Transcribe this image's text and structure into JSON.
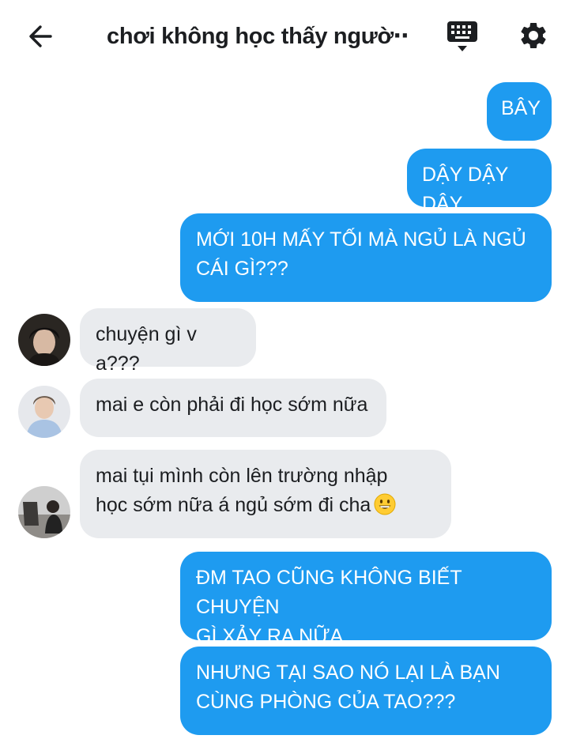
{
  "header": {
    "title": "chơi không học thấy ngườ⋯",
    "back_icon": "arrow-left-icon",
    "keyboard_icon": "keyboard-icon",
    "settings_icon": "gear-icon"
  },
  "colors": {
    "outgoing_bubble": "#1e9bf0",
    "incoming_bubble": "#e9ebee",
    "text_dark": "#1c1e21"
  },
  "messages": [
    {
      "direction": "outgoing",
      "lines": [
        "BÂY"
      ]
    },
    {
      "direction": "outgoing",
      "lines": [
        "DẬY DẬY DẬY"
      ]
    },
    {
      "direction": "outgoing",
      "lines": [
        "MỚI 10H MẤY TỐI MÀ NGỦ LÀ NGỦ",
        "CÁI GÌ???"
      ]
    },
    {
      "direction": "incoming",
      "avatar": "avatar-dark-hair",
      "lines": [
        "chuyện gì v a???"
      ]
    },
    {
      "direction": "incoming",
      "avatar": "avatar-blue-hoodie",
      "lines": [
        "mai e còn phải đi học sớm nữa"
      ]
    },
    {
      "direction": "incoming",
      "avatar": "avatar-room-photo",
      "lines": [
        "mai tụi mình còn lên trường nhập",
        "học sớm nữa á ngủ sớm đi cha"
      ],
      "emoji": "grinning-face-emoji"
    },
    {
      "direction": "outgoing",
      "lines": [
        "ĐM TAO CŨNG KHÔNG BIẾT CHUYỆN",
        "GÌ XẢY RA NỮA"
      ]
    },
    {
      "direction": "outgoing",
      "lines": [
        "NHƯNG TẠI SAO NÓ LẠI LÀ BẠN",
        "CÙNG PHÒNG CỦA TAO???"
      ]
    }
  ]
}
